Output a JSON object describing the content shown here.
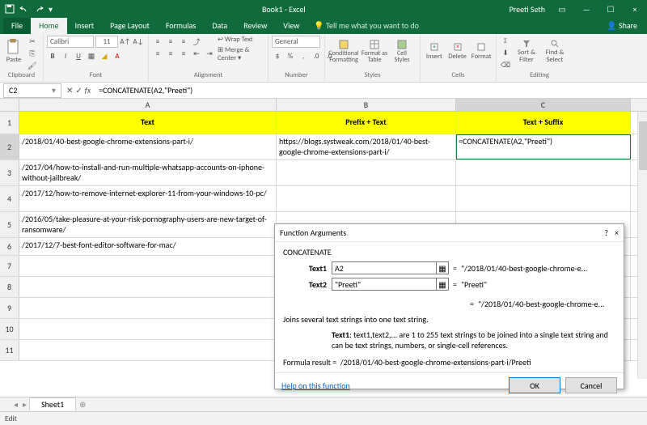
{
  "titlebar": {
    "title": "Book1 - Excel",
    "user": "Preeti Seth"
  },
  "tabs": {
    "file": "File",
    "home": "Home",
    "insert": "Insert",
    "pagelayout": "Page Layout",
    "formulas": "Formulas",
    "data": "Data",
    "review": "Review",
    "view": "View",
    "tellme": "Tell me what you want to do",
    "share": "Share"
  },
  "ribbon": {
    "clipboard": {
      "paste": "Paste",
      "label": "Clipboard"
    },
    "font": {
      "name": "Calibri",
      "size": "11",
      "label": "Font"
    },
    "alignment": {
      "wrap": "Wrap Text",
      "merge": "Merge & Center",
      "label": "Alignment"
    },
    "number": {
      "format": "General",
      "label": "Number"
    },
    "styles": {
      "cond": "Conditional Formatting",
      "tbl": "Format as Table",
      "cell": "Cell Styles",
      "label": "Styles"
    },
    "cells": {
      "insert": "Insert",
      "delete": "Delete",
      "format": "Format",
      "label": "Cells"
    },
    "editing": {
      "sort": "Sort & Filter",
      "find": "Find & Select",
      "label": "Editing"
    }
  },
  "namebox": "C2",
  "formula": "=CONCATENATE(A2,\"Preeti\")",
  "columns": {
    "A": "A",
    "B": "B",
    "C": "C"
  },
  "headers": {
    "A": "Text",
    "B": "Prefix + Text",
    "C": "Text + Suffix"
  },
  "rows": {
    "r2": {
      "A": "/2018/01/40-best-google-chrome-extensions-part-i/",
      "B": "https://blogs.systweak.com/2018/01/40-best-google-chrome-extensions-part-i/",
      "C": "=CONCATENATE(A2,\"Preeti\")"
    },
    "r3": {
      "A": "/2017/04/how-to-install-and-run-multiple-whatsapp-accounts-on-iphone-without-jailbreak/"
    },
    "r4": {
      "A": "/2017/12/how-to-remove-internet-explorer-11-from-your-windows-10-pc/"
    },
    "r5": {
      "A": "/2016/05/take-pleasure-at-your-risk-pornography-users-are-new-target-of-ransomware/"
    },
    "r6": {
      "A": "/2017/12/7-best-font-editor-software-for-mac/"
    }
  },
  "rownums": {
    "r1": "1",
    "r2": "2",
    "r3": "3",
    "r4": "4",
    "r5": "5",
    "r6": "6",
    "r7": "7",
    "r8": "8",
    "r9": "9",
    "r10": "10",
    "r11": "11"
  },
  "sheettabs": {
    "sheet1": "Sheet1"
  },
  "statusbar": {
    "mode": "Edit"
  },
  "dialog": {
    "title": "Function Arguments",
    "fn": "CONCATENATE",
    "arg1label": "Text1",
    "arg1val": "A2",
    "arg1res": "\"/2018/01/40-best-google-chrome-e...",
    "arg2label": "Text2",
    "arg2val": "\"Preeti\"",
    "arg2res": "\"Preeti\"",
    "preview": "\"/2018/01/40-best-google-chrome-e...",
    "desc": "Joins several text strings into one text string.",
    "hint": "Text1: text1,text2,... are 1 to 255 text strings to be joined into a single text string and can be text strings, numbers, or single-cell references.",
    "resultlabel": "Formula result =",
    "result": "/2018/01/40-best-google-chrome-extensions-part-i/Preeti",
    "help": "Help on this function",
    "ok": "OK",
    "cancel": "Cancel"
  }
}
